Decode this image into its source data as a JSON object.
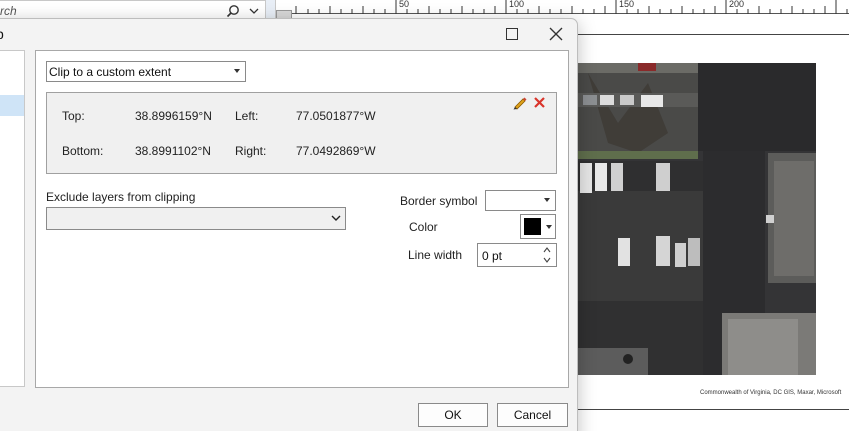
{
  "search": {
    "placeholder_text": "rch"
  },
  "ruler": {
    "labels": [
      "50",
      "100",
      "150",
      "200"
    ]
  },
  "attribution": "Commonwealth of Virginia, DC GIS, Maxar, Microsoft",
  "dialog": {
    "title": "p",
    "clip_mode": {
      "selected": "Clip to a custom extent"
    },
    "extent": {
      "top_label": "Top:",
      "top_value": "38.8996159°N",
      "left_label": "Left:",
      "left_value": "77.0501877°W",
      "bottom_label": "Bottom:",
      "bottom_value": "38.8991102°N",
      "right_label": "Right:",
      "right_value": "77.0492869°W"
    },
    "exclude": {
      "label": "Exclude layers from clipping",
      "selected": ""
    },
    "border": {
      "symbol_label": "Border symbol",
      "color_label": "Color",
      "color_value": "#000000",
      "line_width_label": "Line width",
      "line_width_value": "0 pt"
    },
    "buttons": {
      "ok": "OK",
      "cancel": "Cancel"
    }
  },
  "colors": {
    "selection": "#cfe4f7",
    "delete_x": "#d9342b",
    "pencil": "#e0a21b"
  },
  "icons": [
    "search-icon",
    "chevron-down-icon",
    "maximize-icon",
    "close-icon",
    "pencil-icon",
    "delete-icon",
    "spin-up-icon",
    "spin-down-icon"
  ]
}
